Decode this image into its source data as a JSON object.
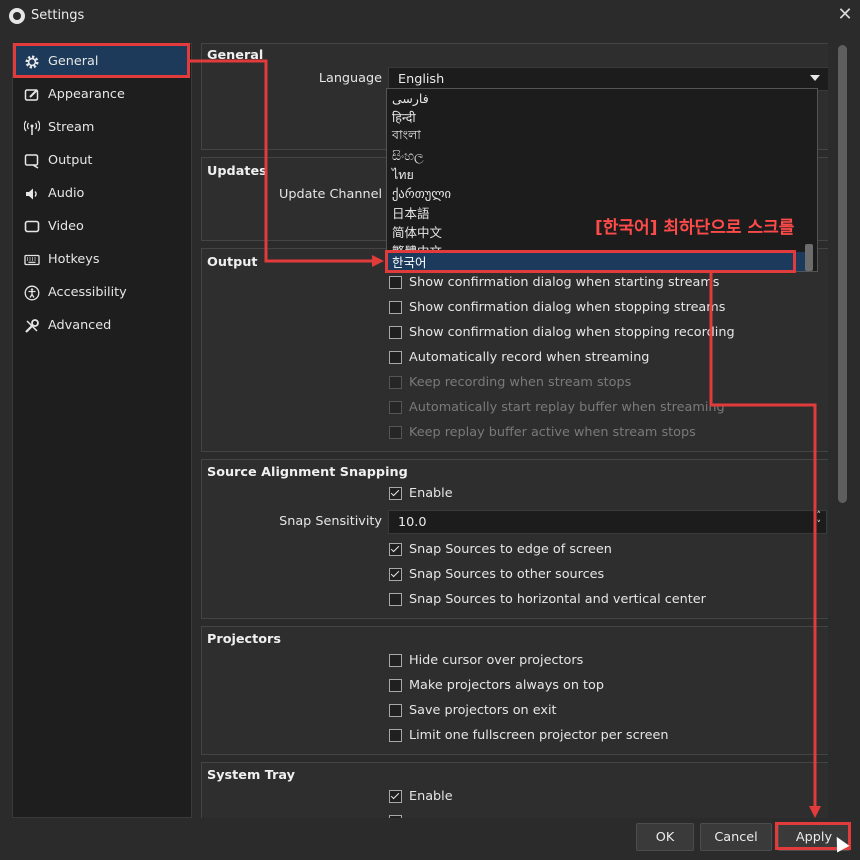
{
  "window": {
    "title": "Settings",
    "close_glyph": "✕"
  },
  "sidebar": {
    "items": [
      {
        "label": "General",
        "icon": "gear-icon"
      },
      {
        "label": "Appearance",
        "icon": "appearance-icon"
      },
      {
        "label": "Stream",
        "icon": "stream-antenna-icon"
      },
      {
        "label": "Output",
        "icon": "output-icon"
      },
      {
        "label": "Audio",
        "icon": "speaker-icon"
      },
      {
        "label": "Video",
        "icon": "monitor-icon"
      },
      {
        "label": "Hotkeys",
        "icon": "keyboard-icon"
      },
      {
        "label": "Accessibility",
        "icon": "accessibility-icon"
      },
      {
        "label": "Advanced",
        "icon": "wrench-icon"
      }
    ],
    "active": "General"
  },
  "general": {
    "title": "General",
    "language_label": "Language",
    "language_value": "English"
  },
  "updates": {
    "title": "Updates",
    "channel_label": "Update Channel"
  },
  "output": {
    "title": "Output",
    "items": [
      {
        "label": "Show confirmation dialog when starting streams",
        "checked": false,
        "enabled": true
      },
      {
        "label": "Show confirmation dialog when stopping streams",
        "checked": false,
        "enabled": true
      },
      {
        "label": "Show confirmation dialog when stopping recording",
        "checked": false,
        "enabled": true
      },
      {
        "label": "Automatically record when streaming",
        "checked": false,
        "enabled": true
      },
      {
        "label": "Keep recording when stream stops",
        "checked": false,
        "enabled": false
      },
      {
        "label": "Automatically start replay buffer when streaming",
        "checked": false,
        "enabled": false
      },
      {
        "label": "Keep replay buffer active when stream stops",
        "checked": false,
        "enabled": false
      }
    ]
  },
  "snapping": {
    "title": "Source Alignment Snapping",
    "enable_label": "Enable",
    "sensitivity_label": "Snap Sensitivity",
    "sensitivity_value": "10.0",
    "items": [
      {
        "label": "Snap Sources to edge of screen",
        "checked": true
      },
      {
        "label": "Snap Sources to other sources",
        "checked": true
      },
      {
        "label": "Snap Sources to horizontal and vertical center",
        "checked": false
      }
    ]
  },
  "projectors": {
    "title": "Projectors",
    "items": [
      {
        "label": "Hide cursor over projectors",
        "checked": false
      },
      {
        "label": "Make projectors always on top",
        "checked": false
      },
      {
        "label": "Save projectors on exit",
        "checked": false
      },
      {
        "label": "Limit one fullscreen projector per screen",
        "checked": false
      }
    ]
  },
  "system_tray": {
    "title": "System Tray",
    "enable_label": "Enable"
  },
  "language_dropdown": {
    "options": [
      "فارسی",
      "हिन्दी",
      "বাংলা",
      "සිංහල",
      "ไทย",
      "ქართული",
      "日本語",
      "简体中文",
      "繁體中文",
      "한국어"
    ],
    "selected": "한국어"
  },
  "buttons": {
    "ok": "OK",
    "cancel": "Cancel",
    "apply": "Apply"
  },
  "annotation": {
    "text": "[한국어] 최하단으로 스크롤",
    "color": "#e23b3b"
  }
}
